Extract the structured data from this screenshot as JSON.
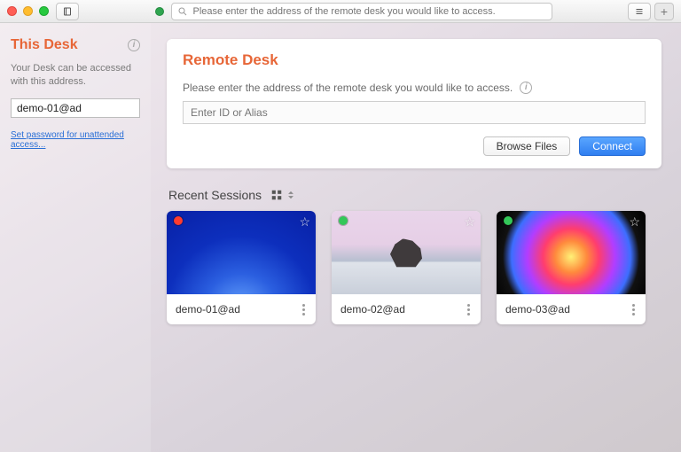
{
  "titlebar": {
    "search_placeholder": "Please enter the address of the remote desk you would like to access."
  },
  "sidebar": {
    "title": "This Desk",
    "description": "Your Desk can be accessed with this address.",
    "address_value": "demo-01@ad",
    "password_link": "Set password for unattended access..."
  },
  "remote": {
    "title": "Remote Desk",
    "description": "Please enter the address of the remote desk you would like to access.",
    "input_placeholder": "Enter ID or Alias",
    "browse_label": "Browse Files",
    "connect_label": "Connect"
  },
  "recent": {
    "title": "Recent Sessions",
    "sessions": [
      {
        "label": "demo-01@ad",
        "status_color": "#ff3b30"
      },
      {
        "label": "demo-02@ad",
        "status_color": "#34c759"
      },
      {
        "label": "demo-03@ad",
        "status_color": "#34c759"
      }
    ]
  }
}
